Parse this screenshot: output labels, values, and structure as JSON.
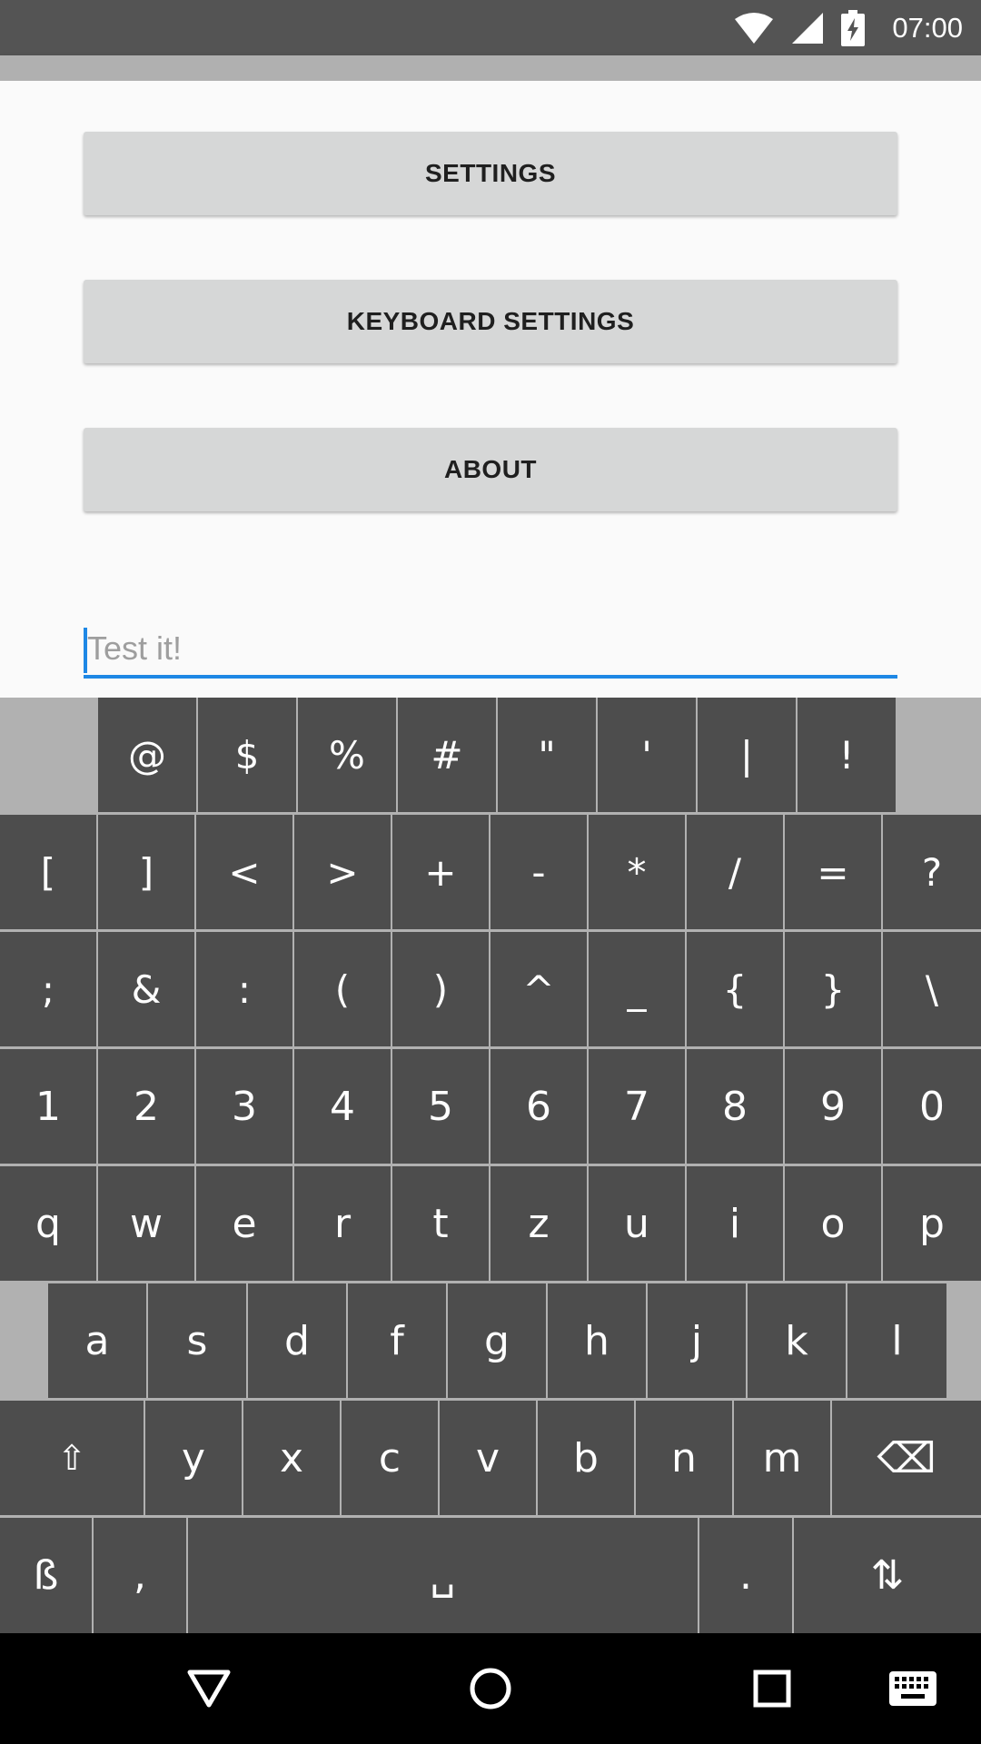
{
  "status_bar": {
    "time": "07:00",
    "icons": [
      "wifi-icon",
      "cell-signal-icon",
      "battery-charging-icon"
    ]
  },
  "buttons": {
    "settings": "SETTINGS",
    "keyboard_settings": "KEYBOARD SETTINGS",
    "about": "ABOUT"
  },
  "test_input": {
    "placeholder": "Test it!",
    "value": ""
  },
  "keyboard": {
    "rows": [
      [
        "@",
        "$",
        "%",
        "#",
        "\"",
        "'",
        "|",
        "!"
      ],
      [
        "[",
        "]",
        "<",
        ">",
        "+",
        "-",
        "*",
        "/",
        "=",
        "?"
      ],
      [
        ";",
        "&",
        ":",
        "(",
        ")",
        "^",
        "_",
        "{",
        "}",
        "\\"
      ],
      [
        "1",
        "2",
        "3",
        "4",
        "5",
        "6",
        "7",
        "8",
        "9",
        "0"
      ],
      [
        "q",
        "w",
        "e",
        "r",
        "t",
        "z",
        "u",
        "i",
        "o",
        "p"
      ],
      [
        "a",
        "s",
        "d",
        "f",
        "g",
        "h",
        "j",
        "k",
        "l"
      ],
      [
        "⇧",
        "y",
        "x",
        "c",
        "v",
        "b",
        "n",
        "m",
        "⌫"
      ],
      [
        "ß",
        ",",
        "␣",
        ".",
        "⇅"
      ]
    ]
  },
  "nav_bar": {
    "icons": [
      "back-icon",
      "home-icon",
      "recents-icon",
      "keyboard-switch-icon"
    ]
  },
  "colors": {
    "status_bar": "#545454",
    "accent": "#1e88e5",
    "key": "#4d4d4d",
    "keyboard_bg": "#b1b1b1",
    "button": "#d6d7d7"
  }
}
